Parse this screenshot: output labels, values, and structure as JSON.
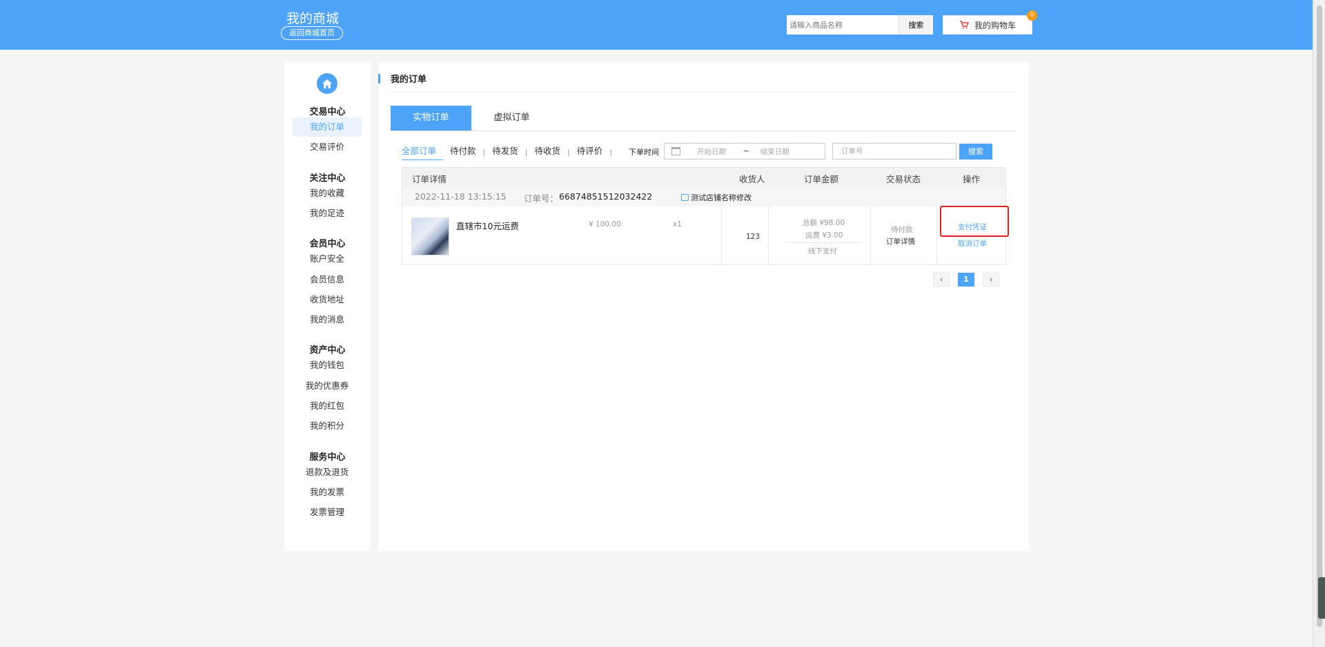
{
  "header": {
    "brand": "我的商城",
    "home_link": "返回商城首页",
    "search_placeholder": "请输入商品名称",
    "search_button": "搜索",
    "cart_label": "我的购物车",
    "cart_count": "0"
  },
  "sidebar": {
    "groups": [
      {
        "title": "交易中心",
        "items": [
          "我的订单",
          "交易评价"
        ]
      },
      {
        "title": "关注中心",
        "items": [
          "我的收藏",
          "我的足迹"
        ]
      },
      {
        "title": "会员中心",
        "items": [
          "账户安全",
          "会员信息",
          "收货地址",
          "我的消息"
        ]
      },
      {
        "title": "资产中心",
        "items": [
          "我的钱包",
          "我的优惠券",
          "我的红包",
          "我的积分"
        ]
      },
      {
        "title": "服务中心",
        "items": [
          "退款及退货",
          "我的发票",
          "发票管理"
        ]
      }
    ],
    "active_item": "我的订单"
  },
  "main": {
    "title": "我的订单",
    "tabs": [
      "实物订单",
      "虚拟订单"
    ],
    "filters": [
      "全部订单",
      "待付款",
      "待发货",
      "待收货",
      "待评价"
    ],
    "separator": "|",
    "time_label": "下单时间",
    "date_start": "开始日期",
    "date_tilde": "~",
    "date_end": "结束日期",
    "orderno_placeholder": "订单号",
    "search_button": "搜索",
    "table_headers": {
      "detail": "订单详情",
      "receiver": "收货人",
      "amount": "订单金额",
      "status": "交易状态",
      "operation": "操作"
    },
    "order": {
      "date": "2022-11-18 13:15:15",
      "order_no_label": "订单号：",
      "order_no": "66874851512032422",
      "shop_name": "测试店铺名称修改",
      "product_name": "直辖市10元运费",
      "price": "¥ 100.00",
      "qty": "x1",
      "receiver": "123",
      "total": "总额 ¥98.00",
      "shipping": "运费 ¥3.00",
      "payment": "线下支付",
      "status": "待付款",
      "detail_link": "订单详情",
      "op_pay": "支付凭证",
      "op_cancel": "取消订单"
    },
    "pager": {
      "prev": "‹",
      "current": "1",
      "next": "›"
    }
  },
  "colors": {
    "primary": "#4da3f7",
    "highlight": "#e02020",
    "badge": "#f39c12"
  }
}
